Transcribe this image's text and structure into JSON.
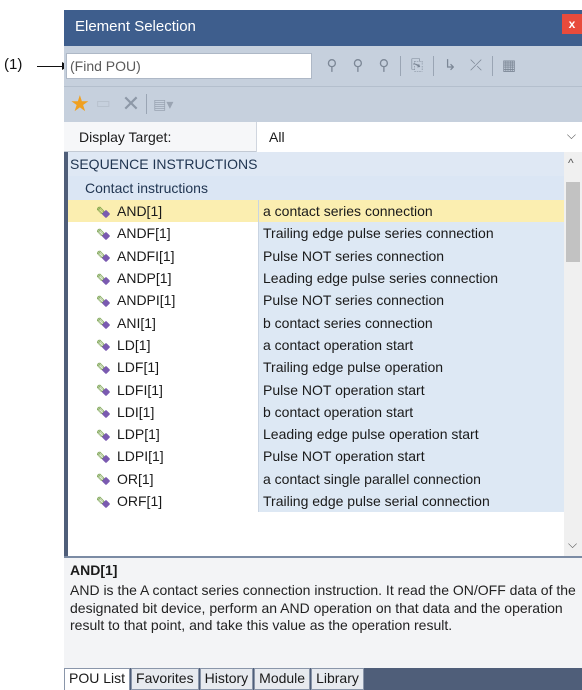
{
  "callout": {
    "label": "(1)"
  },
  "window": {
    "title": "Element Selection",
    "close_symbol": "x"
  },
  "search": {
    "placeholder": "(Find POU)"
  },
  "display": {
    "label": "Display Target:",
    "value": "All"
  },
  "list": {
    "section": "SEQUENCE INSTRUCTIONS",
    "subsection": "Contact instructions",
    "rows": [
      {
        "name": "AND[1]",
        "description": "a contact series connection"
      },
      {
        "name": "ANDF[1]",
        "description": "Trailing edge pulse series connection"
      },
      {
        "name": "ANDFI[1]",
        "description": "Pulse NOT series connection"
      },
      {
        "name": "ANDP[1]",
        "description": "Leading edge pulse series connection"
      },
      {
        "name": "ANDPI[1]",
        "description": "Pulse NOT series connection"
      },
      {
        "name": "ANI[1]",
        "description": "b contact series connection"
      },
      {
        "name": "LD[1]",
        "description": "a contact operation start"
      },
      {
        "name": "LDF[1]",
        "description": "Trailing edge pulse operation"
      },
      {
        "name": "LDFI[1]",
        "description": "Pulse NOT operation start"
      },
      {
        "name": "LDI[1]",
        "description": "b contact operation start"
      },
      {
        "name": "LDP[1]",
        "description": "Leading edge pulse operation start"
      },
      {
        "name": "LDPI[1]",
        "description": "Pulse NOT operation start"
      },
      {
        "name": "OR[1]",
        "description": "a contact single parallel connection"
      },
      {
        "name": "ORF[1]",
        "description": "Trailing edge pulse serial connection"
      }
    ]
  },
  "detail": {
    "title": "AND[1]",
    "text": "AND is the A contact series connection instruction. It read the ON/OFF data of the designated bit device, perform an AND operation on that data and the operation result to that point, and take this value as the operation result."
  },
  "tabs": [
    "POU List",
    "Favorites",
    "History",
    "Module",
    "Library"
  ],
  "colors": {
    "titlebar": "#3e5e8d",
    "selected_row": "#fbeeb0",
    "close_button": "#e84b3c"
  }
}
